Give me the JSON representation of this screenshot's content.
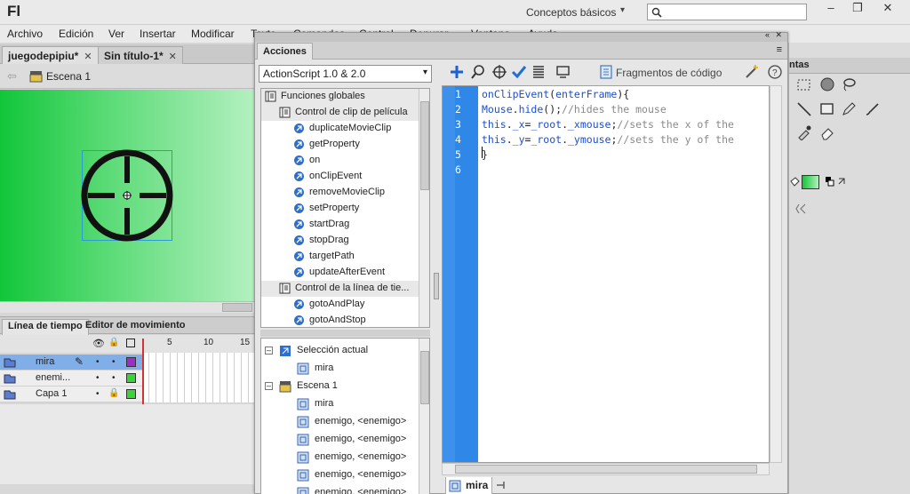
{
  "app": {
    "logo": "Fl",
    "workspace": "Conceptos básicos",
    "search_placeholder": ""
  },
  "window_controls": {
    "minimize": "–",
    "restore": "❐",
    "close": "✕"
  },
  "menu": [
    "Archivo",
    "Edición",
    "Ver",
    "Insertar",
    "Modificar",
    "Texto",
    "Comandos",
    "Control",
    "Depurar",
    "Ventana",
    "Ayuda"
  ],
  "doc_tabs": [
    {
      "label": "juegodepipiu*",
      "active": true
    },
    {
      "label": "Sin título-1*",
      "active": false
    }
  ],
  "scene": {
    "label": "Escena 1"
  },
  "timeline": {
    "tabs": [
      "Línea de tiempo",
      "Editor de movimiento"
    ],
    "frame_numbers": [
      "5",
      "10",
      "15"
    ],
    "layers": [
      {
        "name": "mira",
        "color": "#9a2fc9",
        "selected": true
      },
      {
        "name": "enemi...",
        "color": "#3ad43a",
        "selected": false
      },
      {
        "name": "Capa 1",
        "color": "#3ad43a",
        "selected": false
      }
    ]
  },
  "actions_panel": {
    "title": "Acciones",
    "version_select": "ActionScript 1.0 & 2.0",
    "snippets_label": "Fragmentos de código",
    "toolbox": [
      {
        "label": "Funciones globales",
        "kind": "folder",
        "level": 0
      },
      {
        "label": "Control de clip de película",
        "kind": "folder",
        "level": 1
      },
      {
        "label": "duplicateMovieClip",
        "kind": "item",
        "level": 2
      },
      {
        "label": "getProperty",
        "kind": "item",
        "level": 2
      },
      {
        "label": "on",
        "kind": "item",
        "level": 2
      },
      {
        "label": "onClipEvent",
        "kind": "item",
        "level": 2
      },
      {
        "label": "removeMovieClip",
        "kind": "item",
        "level": 2
      },
      {
        "label": "setProperty",
        "kind": "item",
        "level": 2
      },
      {
        "label": "startDrag",
        "kind": "item",
        "level": 2
      },
      {
        "label": "stopDrag",
        "kind": "item",
        "level": 2
      },
      {
        "label": "targetPath",
        "kind": "item",
        "level": 2
      },
      {
        "label": "updateAfterEvent",
        "kind": "item",
        "level": 2
      },
      {
        "label": "Control de la línea de tie...",
        "kind": "folder",
        "level": 1
      },
      {
        "label": "gotoAndPlay",
        "kind": "item",
        "level": 2
      },
      {
        "label": "gotoAndStop",
        "kind": "item",
        "level": 2
      }
    ],
    "script_nav": [
      {
        "label": "Selección actual",
        "kind": "section"
      },
      {
        "label": "mira",
        "kind": "symbol"
      },
      {
        "label": "Escena 1",
        "kind": "section"
      },
      {
        "label": "mira",
        "kind": "symbol"
      },
      {
        "label": "enemigo, <enemigo>",
        "kind": "symbol"
      },
      {
        "label": "enemigo, <enemigo>",
        "kind": "symbol"
      },
      {
        "label": "enemigo, <enemigo>",
        "kind": "symbol"
      },
      {
        "label": "enemigo, <enemigo>",
        "kind": "symbol"
      },
      {
        "label": "enemigo, <enemigo>",
        "kind": "symbol"
      }
    ],
    "code_lines": [
      {
        "n": "1",
        "code": "onClipEvent(enterFrame){"
      },
      {
        "n": "2",
        "code": "Mouse.hide();//hides the mouse"
      },
      {
        "n": "3",
        "code": "this._x=_root._xmouse;//sets the x of the"
      },
      {
        "n": "4",
        "code": "this._y=_root._ymouse;//sets the y of the"
      },
      {
        "n": "5",
        "code": "}"
      },
      {
        "n": "6",
        "code": ""
      }
    ],
    "script_tab": "mira"
  },
  "right_panel": {
    "tab_label": "ntas"
  }
}
